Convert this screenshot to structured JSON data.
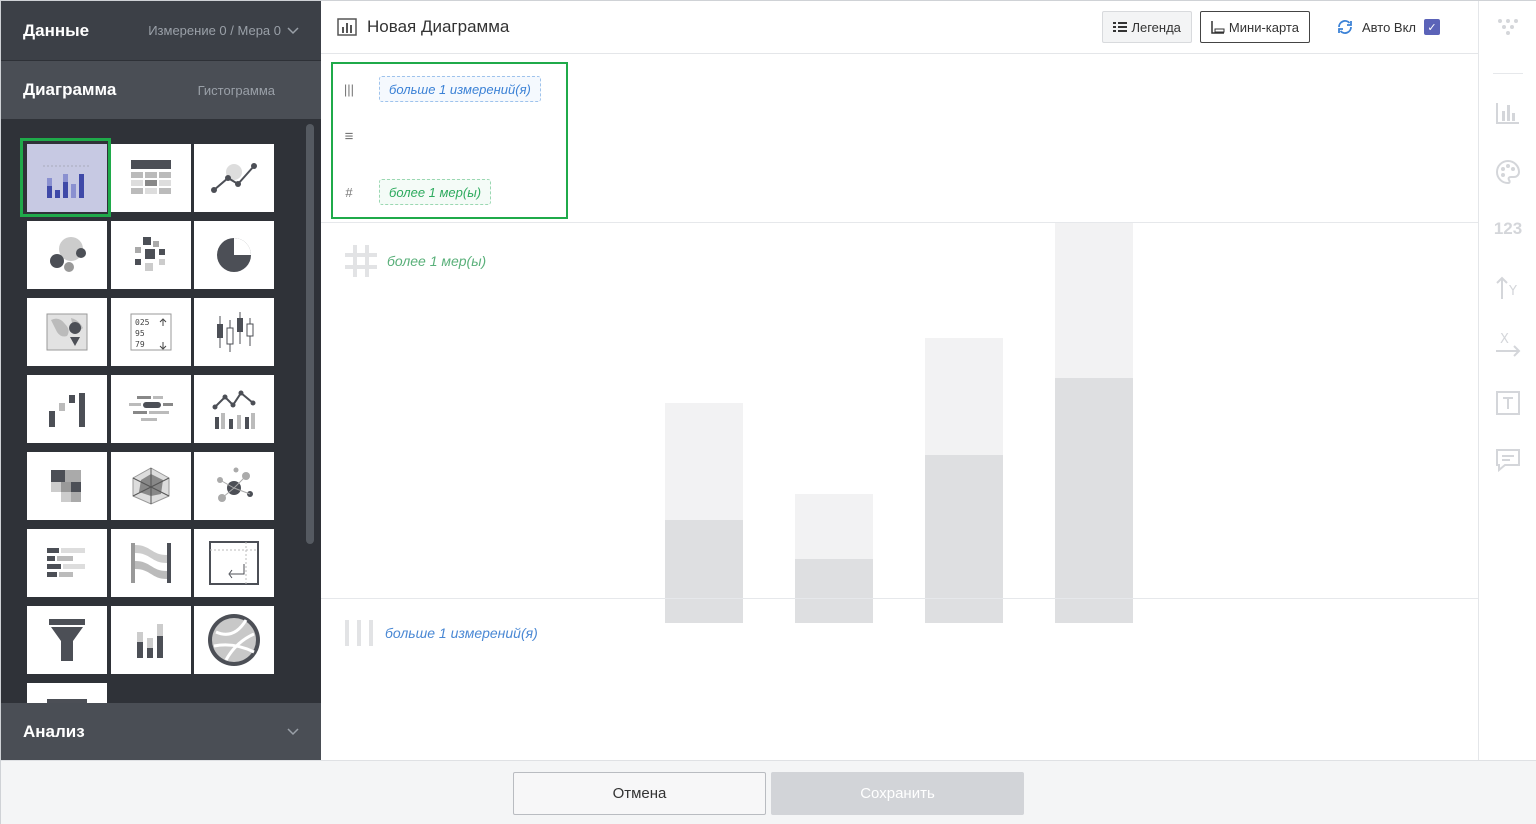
{
  "left": {
    "data_title": "Данные",
    "data_sub": "Измерение 0 / Мера 0",
    "chart_title": "Диаграмма",
    "chart_type": "Гистограмма",
    "analysis_title": "Анализ"
  },
  "header": {
    "title": "Новая Диаграмма",
    "legend": "Легенда",
    "minimap": "Мини-карта",
    "auto": "Авто Вкл"
  },
  "shelf": {
    "dimension_pill": "больше 1 измерений(я)",
    "measure_pill": "более 1 мер(ы)"
  },
  "placeholder": {
    "y_label": "более 1 мер(ы)",
    "x_label": "больше 1 измерений(я)"
  },
  "rightbar": {
    "number_label": "123"
  },
  "footer": {
    "cancel": "Отмена",
    "save": "Сохранить"
  },
  "colors": {
    "selection": "#1faa4a",
    "dimension": "#3c82d6",
    "measure": "#2eab5f",
    "checkbox": "#5b63b8"
  }
}
